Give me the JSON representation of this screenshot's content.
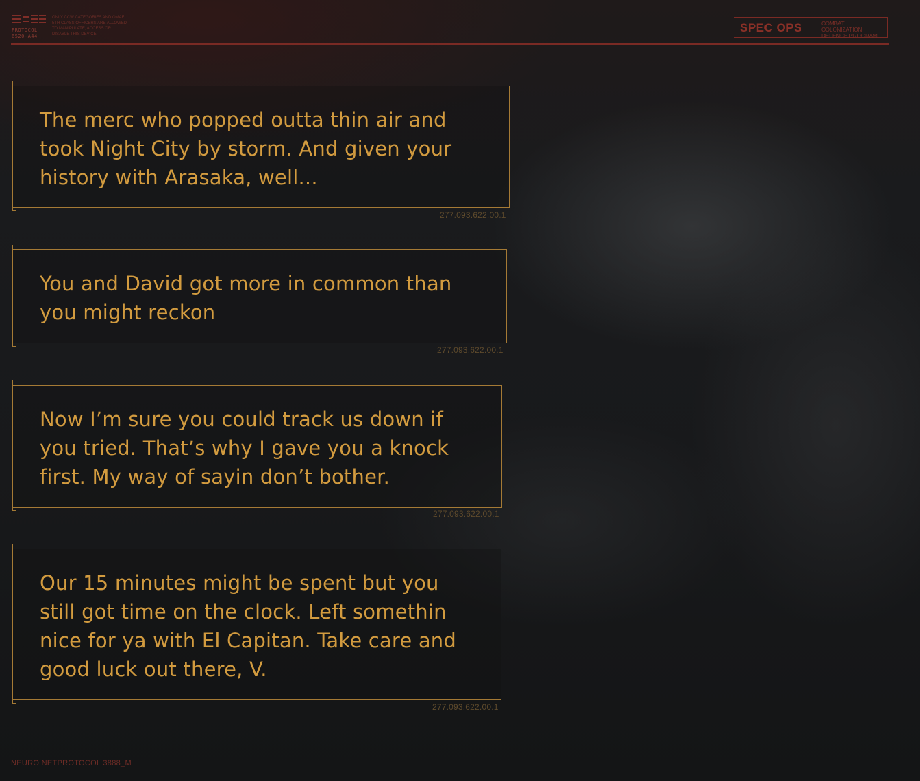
{
  "header": {
    "logo_label": "PROTOCOL",
    "logo_code": "6520-A44",
    "note": "ONLY CCW CATEGORIES AND OMAF 5TH CLASS OFFICERS ARE ALLOWED TO MANIPULATE, ACCESS OR DISABLE THIS DEVICE",
    "spec_ops_label": "SPEC OPS",
    "spec_ops_sub": "COMBAT COLONIZATION DEFENCE PROGRAM"
  },
  "messages": [
    {
      "text": "The merc who popped outta thin air and took Night City by storm. And given your history with Arasaka, well...",
      "code": "277.093.622.00.1"
    },
    {
      "text": "You and David got more in common than you might reckon",
      "code": "277.093.622.00.1"
    },
    {
      "text": "Now I’m sure you could track us down if you tried. That’s why I gave you a knock first. My way of sayin don’t bother.",
      "code": "277.093.622.00.1"
    },
    {
      "text": "Our 15 minutes might be spent but you still got time on the clock. Left somethin nice for ya with El Capitan. Take care and good luck out there, V.",
      "code": "277.093.622.00.1"
    }
  ],
  "footer": {
    "text": "NEURO NETPROTOCOL 3888_M"
  },
  "colors": {
    "accent": "#d29b3f",
    "border": "#a57a35",
    "header_red": "#7a2a24",
    "background": "#17191b"
  }
}
